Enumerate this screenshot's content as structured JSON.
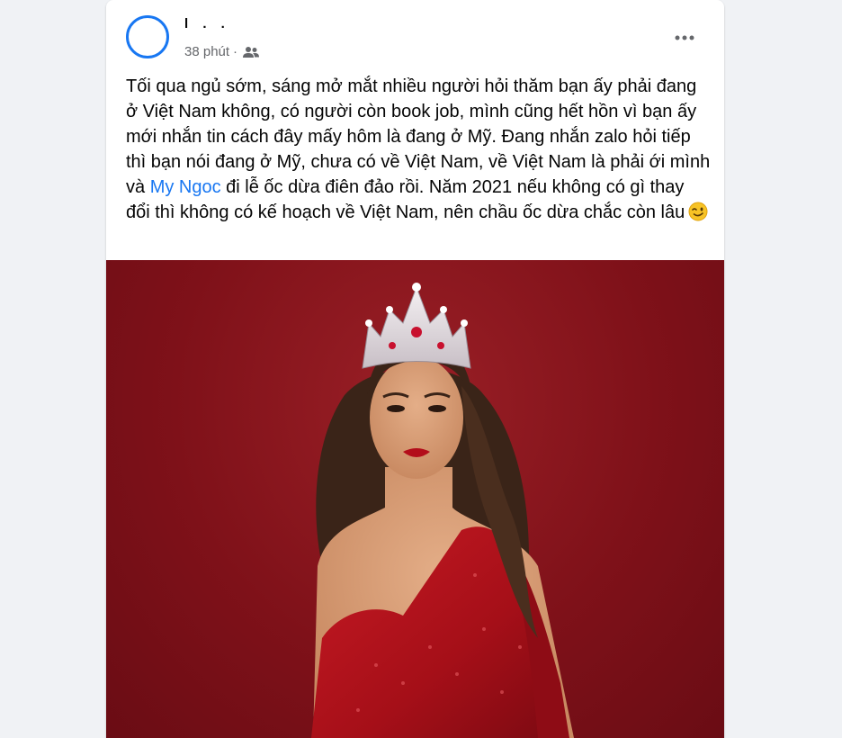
{
  "post": {
    "author": "l . .",
    "time": "38 phút",
    "dot": "·",
    "audience_icon": "friends-icon",
    "more_icon": "more-options-icon",
    "text_part1": "Tối qua ngủ sớm, sáng mở mắt nhiều người hỏi thăm bạn ấy phải đang ở Việt Nam không, có người còn book job, mình cũng hết hồn vì bạn ấy mới nhắn tin cách đây mấy hôm là đang ở Mỹ. Đang nhắn zalo hỏi tiếp thì bạn nói đang ở Mỹ, chưa có về Việt Nam, về Việt Nam là phải ới mình và ",
    "mention": "My Ngoc",
    "text_part2": " đi lễ ốc dừa điên đảo rồi. Năm 2021 nếu không có gì thay đổi thì không có kế hoạch về Việt Nam, nên chầu ốc dừa chắc còn lâu",
    "emoji_icon": "wink-emoji-icon"
  },
  "colors": {
    "accent": "#1877f2",
    "photo_background": "#7f1119",
    "dress": "#b3121c"
  }
}
